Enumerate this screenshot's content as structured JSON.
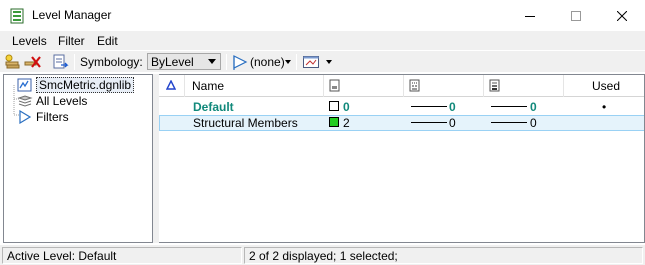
{
  "window": {
    "title": "Level Manager",
    "icon": "level-manager-icon"
  },
  "menu": {
    "items": [
      "Levels",
      "Filter",
      "Edit"
    ]
  },
  "toolbar": {
    "symbology_label": "Symbology:",
    "symbology_value": "ByLevel",
    "filter_value": "(none)"
  },
  "tree": {
    "items": [
      {
        "label": "SmcMetric.dgnlib",
        "icon": "dgnlib-file-icon"
      },
      {
        "label": "All Levels",
        "icon": "all-levels-icon"
      },
      {
        "label": "Filters",
        "icon": "filter-icon"
      }
    ]
  },
  "grid": {
    "headers": {
      "name": "Name",
      "used": "Used"
    },
    "rows": [
      {
        "name": "Default",
        "color": "0",
        "style": "0",
        "weight": "0",
        "used": "•",
        "swatch": "#ffffff"
      },
      {
        "name": "Structural Members",
        "color": "2",
        "style": "0",
        "weight": "0",
        "used": "",
        "swatch": "#22cc22"
      }
    ]
  },
  "status": {
    "active_level": "Active Level: Default",
    "selection": "2 of 2 displayed; 1 selected;"
  },
  "colors": {
    "accent_teal": "#11897b",
    "selection_bg": "#e5f3fb"
  }
}
